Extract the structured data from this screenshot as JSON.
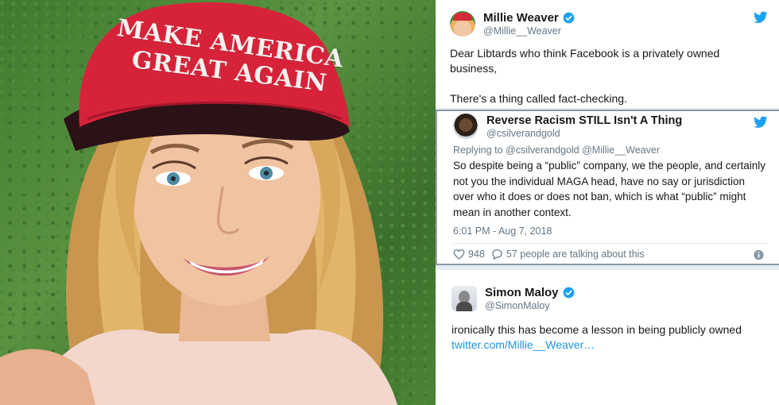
{
  "photo": {
    "hat_line1": "MAKE AMERICA",
    "hat_line2": "GREAT AGAIN",
    "colors": {
      "hat": "#d7233a",
      "grass": "#4b8437",
      "hair": "#d6a65b",
      "skin": "#efc3a0"
    }
  },
  "tweets": [
    {
      "name": "Millie Weaver",
      "handle": "@Millie__Weaver",
      "verified": true,
      "text_p1": "Dear Libtards who think Facebook is a privately owned business,",
      "text_p2": "There's a thing called fact-checking."
    },
    {
      "name": "Reverse Racism STILL Isn't A Thing",
      "handle": "@csilverandgold",
      "replying_label": "Replying to",
      "replying_to": "@csilverandgold @Millie__Weaver",
      "text": "So despite being a “public” company, we the people, and certainly not you the individual MAGA head, have no say or jurisdiction over who it does or does not ban, which is what “public” might mean in another context.",
      "timestamp": "6:01 PM - Aug 7, 2018",
      "likes": "948",
      "replies_text": "57 people are talking about this"
    },
    {
      "name": "Simon Maloy",
      "handle": "@SimonMaloy",
      "verified": true,
      "text": "ironically this has become a lesson in being publicly owned",
      "link": "twitter.com/Millie__Weaver…"
    }
  ],
  "colors": {
    "twitter_blue": "#1da1f2",
    "link": "#1b95e0",
    "muted": "#657786",
    "text": "#14171a"
  },
  "icons": [
    "twitter-bird-icon",
    "verified-badge-icon",
    "heart-icon",
    "reply-bubble-icon",
    "info-icon"
  ]
}
